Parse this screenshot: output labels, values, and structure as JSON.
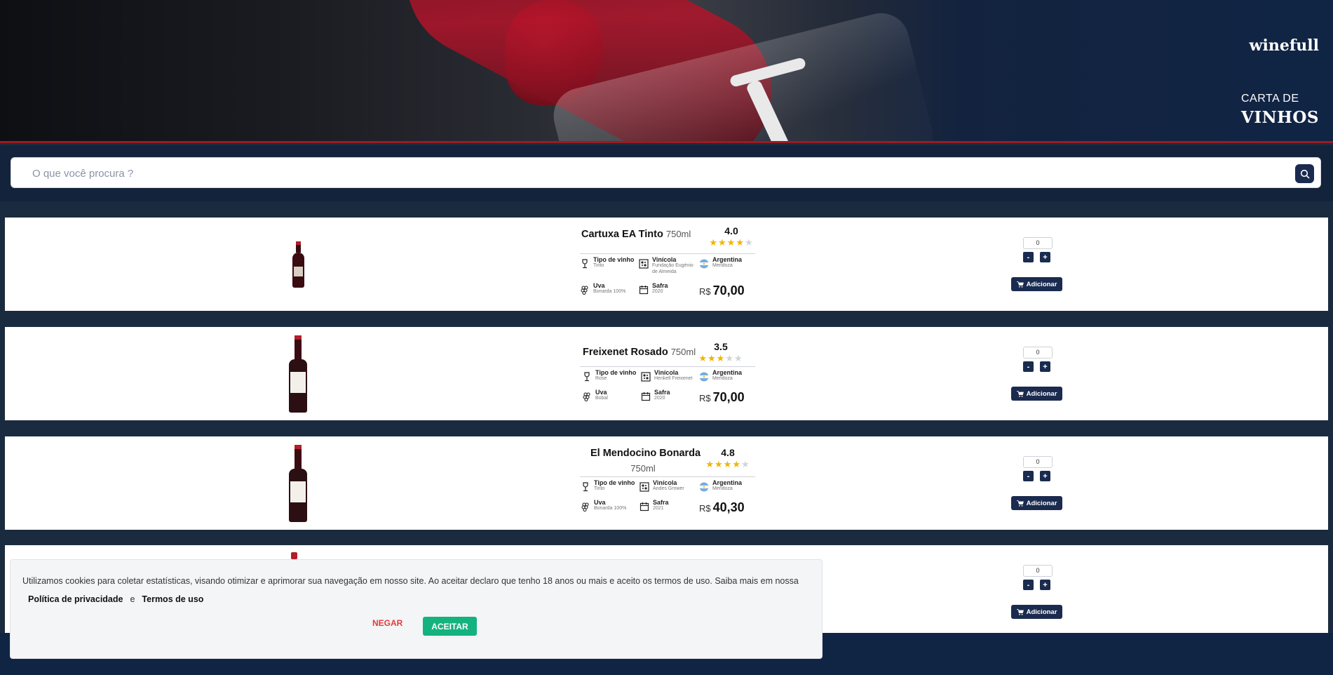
{
  "header": {
    "brand": "winefull",
    "subtitle_line1": "CARTA DE",
    "subtitle_line2": "VINHOS"
  },
  "search": {
    "placeholder": "O que você procura ?",
    "button_icon": "search-icon"
  },
  "labels": {
    "tipo": "Tipo de vinho",
    "vinicola": "Vinícola",
    "uva": "Uva",
    "safra": "Safra",
    "currency": "R$",
    "add_button": "Adicionar",
    "minus": "-",
    "plus": "+"
  },
  "products": [
    {
      "name": "Cartuxa EA Tinto",
      "volume": "750ml",
      "rating": "4.0",
      "stars_filled": 4,
      "tipo": "Tinto",
      "vinicola": "Fundação Eugénio de Almeida",
      "pais": "Argentina",
      "regiao": "Mendoza",
      "uva": "Bonarda 100%",
      "safra": "2020",
      "preco": "70,00",
      "quantidade": "0"
    },
    {
      "name": "Freixenet Rosado",
      "volume": "750ml",
      "rating": "3.5",
      "stars_filled": 3,
      "tipo": "Rose",
      "vinicola": "Henkell Freixenet",
      "pais": "Argentina",
      "regiao": "Mendoza",
      "uva": "Bobal",
      "safra": "2020",
      "preco": "70,00",
      "quantidade": "0"
    },
    {
      "name": "El Mendocino Bonarda",
      "volume": "750ml",
      "rating": "4.8",
      "stars_filled": 4,
      "tipo": "Tinto",
      "vinicola": "Andes Grower",
      "pais": "Argentina",
      "regiao": "Mendoza",
      "uva": "Bonarda 100%",
      "safra": "2021",
      "preco": "40,30",
      "quantidade": "0"
    },
    {
      "quantidade": "0"
    }
  ],
  "cookie": {
    "message": "Utilizamos cookies para coletar estatísticas, visando otimizar e aprimorar sua navegação em nosso site. Ao aceitar declaro que tenho 18 anos ou mais e aceito os termos de uso. Saiba mais em nossa",
    "privacy_link": "Política de privacidade",
    "conjunction": "e",
    "terms_link": "Termos de uso",
    "deny": "NEGAR",
    "accept": "ACEITAR"
  },
  "colors": {
    "navy": "#1a2b4f",
    "accept_green": "#14b37e",
    "deny_red": "#e23b3b",
    "star": "#f0b400"
  }
}
